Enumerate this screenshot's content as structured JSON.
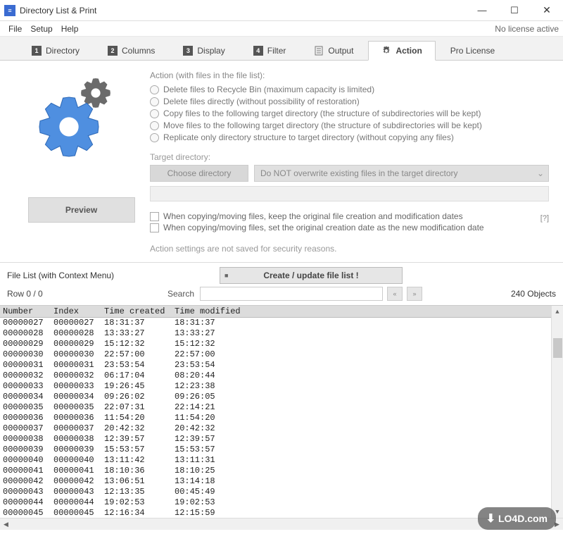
{
  "window": {
    "title": "Directory List & Print",
    "license": "No license active"
  },
  "menu": {
    "file": "File",
    "setup": "Setup",
    "help": "Help"
  },
  "tabs": [
    {
      "num": "1",
      "label": "Directory"
    },
    {
      "num": "2",
      "label": "Columns"
    },
    {
      "num": "3",
      "label": "Display"
    },
    {
      "num": "4",
      "label": "Filter"
    },
    {
      "num": "",
      "label": "Output",
      "icon": "doc-icon"
    },
    {
      "num": "",
      "label": "Action",
      "icon": "gear-icon",
      "active": true
    },
    {
      "num": "",
      "label": "Pro License"
    }
  ],
  "action": {
    "heading": "Action (with files in the file list):",
    "options": [
      "Delete files to Recycle Bin (maximum capacity is limited)",
      "Delete files directly (without possibility of restoration)",
      "Copy files to the following target directory (the structure of subdirectories will be kept)",
      "Move files to the following target directory (the structure of subdirectories will be kept)",
      "Replicate only directory structure to target directory (without copying any files)"
    ],
    "target_label": "Target directory:",
    "choose_btn": "Choose directory",
    "overwrite": "Do NOT overwrite existing files in the target directory",
    "checks": [
      "When copying/moving files, keep the original file creation and modification dates",
      "When copying/moving files, set the original creation date as the new modification date"
    ],
    "help": "[?]",
    "note": "Action settings are not saved for security reasons.",
    "preview_btn": "Preview"
  },
  "filelist": {
    "header": "File List (with Context Menu)",
    "create_btn": "Create / update file list !",
    "row_info": "Row 0 / 0",
    "search_label": "Search",
    "search_value": "",
    "nav_prev": "«",
    "nav_next": "»",
    "objects": "240 Objects",
    "columns": {
      "number": "Number",
      "index": "Index",
      "tc": "Time created",
      "tm": "Time modified"
    },
    "rows": [
      {
        "number": "00000027",
        "index": "00000027",
        "tc": "18:31:37",
        "tm": "18:31:37"
      },
      {
        "number": "00000028",
        "index": "00000028",
        "tc": "13:33:27",
        "tm": "13:33:27"
      },
      {
        "number": "00000029",
        "index": "00000029",
        "tc": "15:12:32",
        "tm": "15:12:32"
      },
      {
        "number": "00000030",
        "index": "00000030",
        "tc": "22:57:00",
        "tm": "22:57:00"
      },
      {
        "number": "00000031",
        "index": "00000031",
        "tc": "23:53:54",
        "tm": "23:53:54"
      },
      {
        "number": "00000032",
        "index": "00000032",
        "tc": "06:17:04",
        "tm": "08:20:44"
      },
      {
        "number": "00000033",
        "index": "00000033",
        "tc": "19:26:45",
        "tm": "12:23:38"
      },
      {
        "number": "00000034",
        "index": "00000034",
        "tc": "09:26:02",
        "tm": "09:26:05"
      },
      {
        "number": "00000035",
        "index": "00000035",
        "tc": "22:07:31",
        "tm": "22:14:21"
      },
      {
        "number": "00000036",
        "index": "00000036",
        "tc": "11:54:20",
        "tm": "11:54:20"
      },
      {
        "number": "00000037",
        "index": "00000037",
        "tc": "20:42:32",
        "tm": "20:42:32"
      },
      {
        "number": "00000038",
        "index": "00000038",
        "tc": "12:39:57",
        "tm": "12:39:57"
      },
      {
        "number": "00000039",
        "index": "00000039",
        "tc": "15:53:57",
        "tm": "15:53:57"
      },
      {
        "number": "00000040",
        "index": "00000040",
        "tc": "13:11:42",
        "tm": "13:11:31"
      },
      {
        "number": "00000041",
        "index": "00000041",
        "tc": "18:10:36",
        "tm": "18:10:25"
      },
      {
        "number": "00000042",
        "index": "00000042",
        "tc": "13:06:51",
        "tm": "13:14:18"
      },
      {
        "number": "00000043",
        "index": "00000043",
        "tc": "12:13:35",
        "tm": "00:45:49"
      },
      {
        "number": "00000044",
        "index": "00000044",
        "tc": "19:02:53",
        "tm": "19:02:53"
      },
      {
        "number": "00000045",
        "index": "00000045",
        "tc": "12:16:34",
        "tm": "12:15:59"
      }
    ]
  },
  "watermark": "LO4D.com"
}
